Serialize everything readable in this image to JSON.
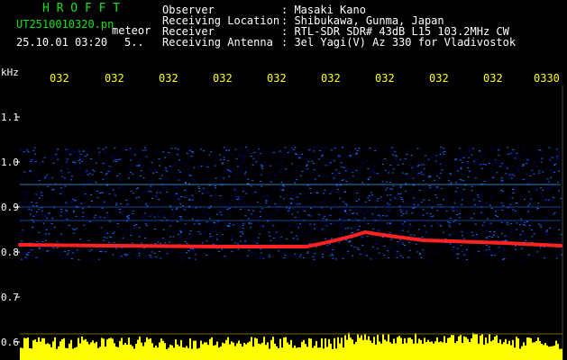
{
  "app": {
    "name": "H R O F F T",
    "filename": "UT2510010320.pn",
    "mode": "meteor",
    "datetime": "25.10.01 03:20",
    "value": "5.."
  },
  "info": {
    "observer_label": "Observer",
    "observer_value": ": Masaki Kano",
    "location_label": "Receiving Location",
    "location_value": ": Shibukawa, Gunma, Japan",
    "receiver_label": "Receiver",
    "receiver_value": ": RTL-SDR SDR# 43dB L15 103.2MHz CW",
    "antenna_label": "Receiving Antenna",
    "antenna_value": ": 3el Yagi(V) Az 330 for Vladivostok"
  },
  "axis": {
    "unit": "kHz",
    "y_ticks": [
      "1.1",
      "1.0",
      "0.9",
      "0.8",
      "0.7",
      "0.6"
    ],
    "time_ticks": [
      "032",
      "032",
      "032",
      "032",
      "032",
      "032",
      "032",
      "032",
      "032",
      "0330"
    ]
  },
  "colors": {
    "background": "#000000",
    "app_title": "#19e019",
    "time_labels": "#ffff00",
    "noise_dark": "#00007a",
    "noise_light": "#1e6bff",
    "trace": "#ff2222",
    "audio_bar": "#ffff00"
  }
}
